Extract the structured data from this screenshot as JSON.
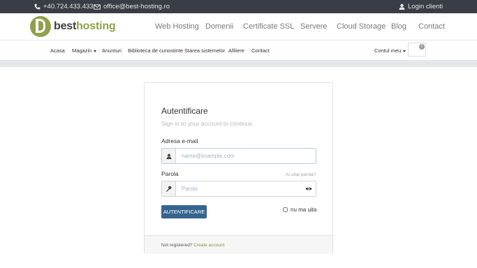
{
  "topbar": {
    "phone": "+40.724.433.433",
    "email": "office@best-hosting.ro",
    "login": "Login clienti",
    "icons": [
      "phone-icon",
      "mail-icon",
      "user-icon"
    ]
  },
  "brand": {
    "part1": "best",
    "part2": "hosting",
    "accent": "#8ea24a"
  },
  "nav": [
    "Web Hosting",
    "Domenii",
    "Certificate SSL",
    "Servere",
    "Cloud Storage",
    "Blog",
    "Contact"
  ],
  "subnav": {
    "items": [
      "Acasa",
      "Magazin",
      "Anunturi",
      "Biblioteca de cunostinte",
      "Starea sistemelor",
      "Afiliere",
      "Contact"
    ],
    "account": "Contul meu",
    "cart_count": "0"
  },
  "login": {
    "title": "Autentificare",
    "subtitle": "Sign in to your account to continue.",
    "email_label": "Adresa e-mail",
    "email_placeholder": "name@example.com",
    "password_label": "Parola",
    "forgot": "Ai uitat parola?",
    "password_placeholder": "Parola",
    "submit": "AUTENTIFICARE",
    "remember": "nu ma uita",
    "footer_text": "Not registered?",
    "footer_link": "Create account"
  },
  "colors": {
    "topbar": "#3a3d45",
    "primary_button": "#35648f",
    "link": "#7d9a3b"
  }
}
